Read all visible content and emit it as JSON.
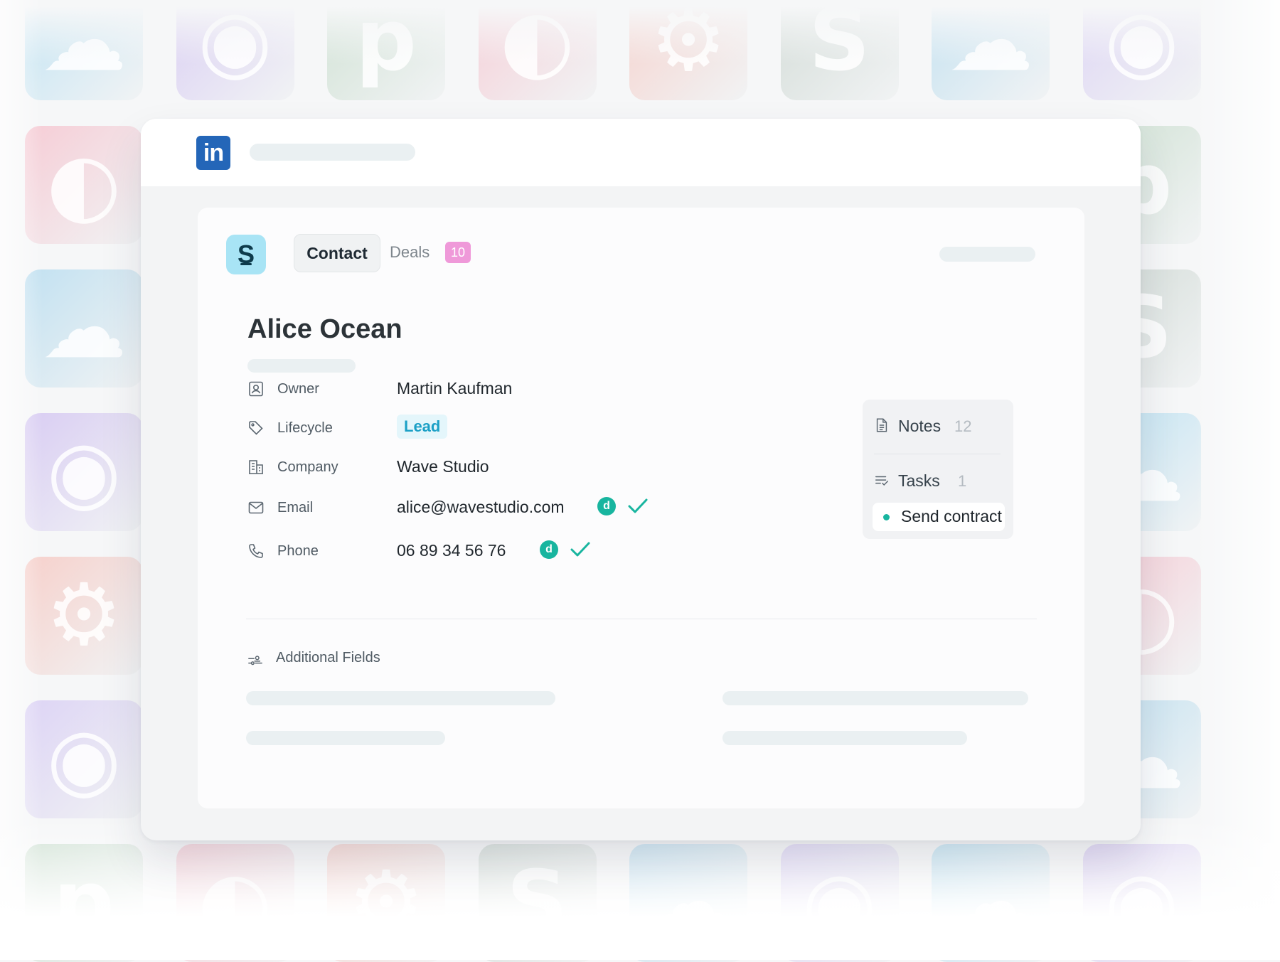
{
  "background_tiles": [
    {
      "glyph": "☁",
      "color": "#bfe3f3"
    },
    {
      "glyph": "◉",
      "color": "#d9cdf3"
    },
    {
      "glyph": "p",
      "color": "#cfe1d3"
    },
    {
      "glyph": "◐",
      "color": "#f6cdd6"
    },
    {
      "glyph": "⚙",
      "color": "#f6d1cc"
    },
    {
      "glyph": "S",
      "color": "#d2dbd6"
    },
    {
      "glyph": "☁",
      "color": "#c2e1f1"
    },
    {
      "glyph": "◉",
      "color": "#ddd4f5"
    }
  ],
  "browser": {
    "site_logo_text": "in",
    "site_logo_color": "#2466b8"
  },
  "app": {
    "logo_letter": "S",
    "tabs": {
      "contact_label": "Contact",
      "deals_label": "Deals",
      "deals_count": "10"
    }
  },
  "contact": {
    "name": "Alice Ocean",
    "fields": {
      "owner": {
        "label": "Owner",
        "value": "Martin Kaufman",
        "icon": "user-badge-icon"
      },
      "lifecycle": {
        "label": "Lifecycle",
        "value": "Lead",
        "icon": "tag-icon"
      },
      "company": {
        "label": "Company",
        "value": "Wave Studio",
        "icon": "building-icon"
      },
      "email": {
        "label": "Email",
        "value": "alice@wavestudio.com",
        "icon": "mail-icon",
        "verified_badge": "d"
      },
      "phone": {
        "label": "Phone",
        "value": "06 89 34 56 76",
        "icon": "phone-icon",
        "verified_badge": "d"
      }
    }
  },
  "side_panel": {
    "notes": {
      "label": "Notes",
      "count": "12"
    },
    "tasks": {
      "label": "Tasks",
      "count": "1"
    },
    "task_item": "Send contract"
  },
  "additional_fields": {
    "label": "Additional Fields"
  },
  "colors": {
    "accent_green": "#18b59f",
    "lead_blue": "#1ba0c6",
    "deals_badge_pink": "#ef99d9",
    "app_logo_bg": "#a8e4f5"
  }
}
